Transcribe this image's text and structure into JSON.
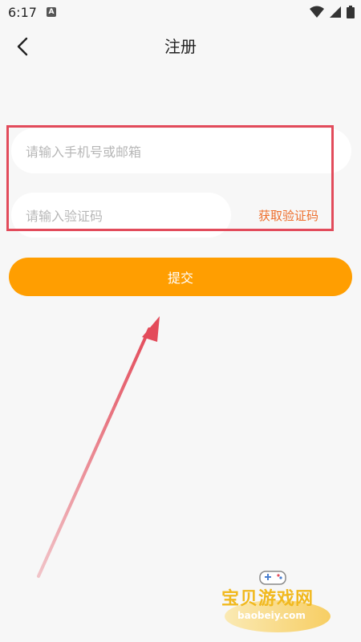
{
  "status_bar": {
    "time": "6:17",
    "notification_icon": "A",
    "icons": [
      "wifi-icon",
      "signal-icon",
      "battery-icon"
    ]
  },
  "header": {
    "title": "注册",
    "back_icon": "chevron-left-icon"
  },
  "form": {
    "phone_placeholder": "请输入手机号或邮箱",
    "code_placeholder": "请输入验证码",
    "get_code_label": "获取验证码",
    "submit_label": "提交"
  },
  "watermark": {
    "title": "宝贝游戏网",
    "url": "baobeiy.com"
  },
  "colors": {
    "accent": "#ff9e01",
    "link": "#ee6f2d",
    "highlight": "#e24b5b",
    "background": "#f7f7f7"
  }
}
